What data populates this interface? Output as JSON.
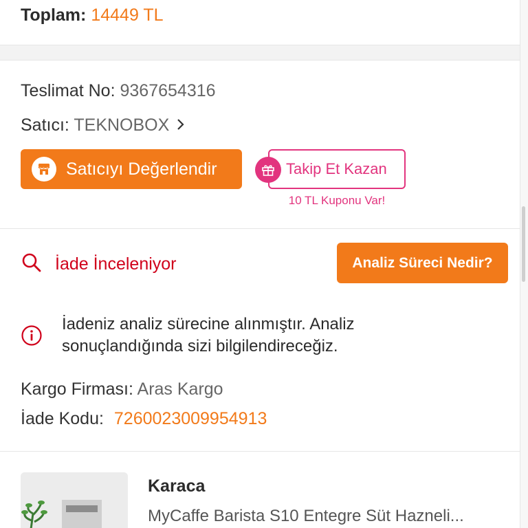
{
  "order_summary": {
    "total_label": "Toplam:",
    "total_value": "14449 TL"
  },
  "delivery": {
    "delivery_no_label": "Teslimat No:",
    "delivery_no_value": "9367654316",
    "seller_label": "Satıcı:",
    "seller_value": "TEKNOBOX",
    "rate_seller_button": "Satıcıyı Değerlendir",
    "follow_button": "Takip Et Kazan",
    "coupon_note": "10 TL Kuponu Var!"
  },
  "return": {
    "status_text": "İade İnceleniyor",
    "analysis_button": "Analiz Süreci Nedir?",
    "notice_text": "İadeniz analiz sürecine alınmıştır. Analiz sonuçlandığında sizi bilgilendireceğiz.",
    "cargo_label": "Kargo Firması:",
    "cargo_value": "Aras Kargo",
    "return_code_label": "İade Kodu:",
    "return_code_value": "7260023009954913"
  },
  "product": {
    "brand": "Karaca",
    "name": "MyCaffe Barista S10 Entegre Süt Hazneli..."
  },
  "icons": {
    "store": "store-icon",
    "gift": "gift-icon",
    "search": "search-icon",
    "info": "info-icon",
    "chevron": "chevron-right-icon"
  },
  "colors": {
    "accent_orange": "#f27a1a",
    "accent_pink": "#e2347e",
    "status_red": "#d0021b"
  }
}
